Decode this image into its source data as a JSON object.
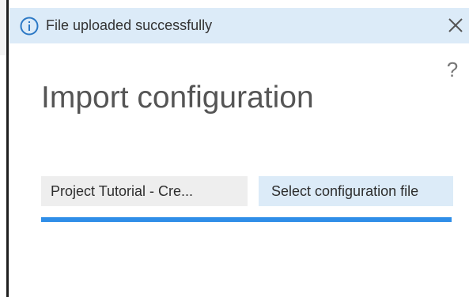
{
  "colors": {
    "notification_bg": "#dcebf8",
    "primary": "#2f8ee8",
    "text": "#333333"
  },
  "notification": {
    "icon": "info-icon",
    "message": "File uploaded successfully",
    "close_icon": "close-icon"
  },
  "dialog": {
    "help_label": "?",
    "title": "Import configuration",
    "file_name": "Project Tutorial - Cre...",
    "select_button_label": "Select configuration file",
    "progress": 1.0
  }
}
